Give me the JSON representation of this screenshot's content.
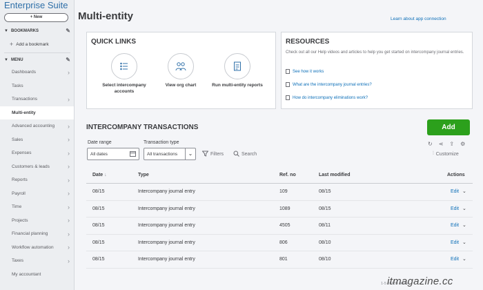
{
  "app": {
    "title": "Enterprise Suite",
    "new_label": "+ New"
  },
  "sidebar": {
    "bookmarks_label": "BOOKMARKS",
    "add_bookmark": "Add a bookmark",
    "menu_label": "MENU",
    "items": [
      {
        "label": "Dashboards",
        "has_chevron": true
      },
      {
        "label": "Tasks",
        "has_chevron": false
      },
      {
        "label": "Transactions",
        "has_chevron": true
      },
      {
        "label": "Multi-entity",
        "has_chevron": false,
        "active": true
      },
      {
        "label": "Advanced accounting",
        "has_chevron": true
      },
      {
        "label": "Sales",
        "has_chevron": true
      },
      {
        "label": "Expenses",
        "has_chevron": true
      },
      {
        "label": "Customers & leads",
        "has_chevron": true
      },
      {
        "label": "Reports",
        "has_chevron": true
      },
      {
        "label": "Payroll",
        "has_chevron": true
      },
      {
        "label": "Time",
        "has_chevron": true
      },
      {
        "label": "Projects",
        "has_chevron": true
      },
      {
        "label": "Financial planning",
        "has_chevron": true
      },
      {
        "label": "Workflow automation",
        "has_chevron": true
      },
      {
        "label": "Taxes",
        "has_chevron": true
      },
      {
        "label": "My accountant",
        "has_chevron": false
      }
    ]
  },
  "header": {
    "title": "Multi-entity",
    "learn_link": "Learn about app connection"
  },
  "quick_links": {
    "title": "QUICK LINKS",
    "items": [
      {
        "label": "Select intercompany accounts",
        "icon": "list-icon"
      },
      {
        "label": "View org chart",
        "icon": "people-icon"
      },
      {
        "label": "Run multi-entity reports",
        "icon": "report-icon"
      }
    ]
  },
  "resources": {
    "title": "RESOURCES",
    "description": "Check out all our Help videos and articles to help you get started on intercompany journal entries.",
    "links": [
      "See how it works",
      "What are the intercompany journal entries?",
      "How do intercompany eliminations work?"
    ]
  },
  "transactions": {
    "title": "INTERCOMPANY TRANSACTIONS",
    "add_label": "Add",
    "date_range_label": "Date range",
    "date_range_value": "All dates",
    "type_label": "Transaction type",
    "type_value": "All transactions",
    "filters_label": "Filters",
    "search_label": "Search",
    "customize_label": "Customize",
    "columns": [
      "Date",
      "Type",
      "Ref. no",
      "Last modified",
      "Actions"
    ],
    "rows": [
      {
        "date": "08/15",
        "type": "Intercompany journal entry",
        "ref": "109",
        "modified": "08/15",
        "action": "Edit"
      },
      {
        "date": "08/15",
        "type": "Intercompany journal entry",
        "ref": "1089",
        "modified": "08/15",
        "action": "Edit"
      },
      {
        "date": "08/15",
        "type": "Intercompany journal entry",
        "ref": "4505",
        "modified": "08/11",
        "action": "Edit"
      },
      {
        "date": "08/15",
        "type": "Intercompany journal entry",
        "ref": "806",
        "modified": "08/10",
        "action": "Edit"
      },
      {
        "date": "08/15",
        "type": "Intercompany journal entry",
        "ref": "801",
        "modified": "08/10",
        "action": "Edit"
      }
    ],
    "pagination": "1-5 of 635 items"
  },
  "watermark": "itmagazine.cc",
  "colors": {
    "accent_green": "#2ca01c",
    "link_blue": "#0d6fb8",
    "brand_blue": "#2e6fa8"
  }
}
